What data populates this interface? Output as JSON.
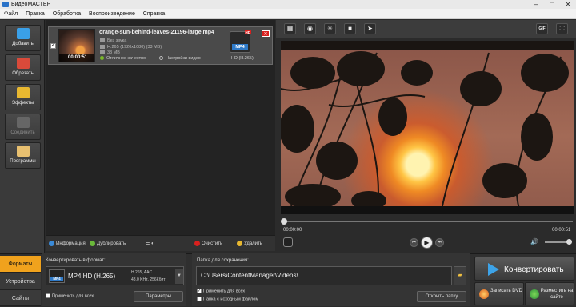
{
  "window": {
    "title": "ВидеоМАСТЕР"
  },
  "menu": [
    "Файл",
    "Правка",
    "Обработка",
    "Воспроизведение",
    "Справка"
  ],
  "sidebar": {
    "items": [
      {
        "label": "Добавить",
        "icon": "add-icon",
        "color": "#3aa0e8"
      },
      {
        "label": "Обрезать",
        "icon": "cut-icon",
        "color": "#d94a3a"
      },
      {
        "label": "Эффекты",
        "icon": "effects-icon",
        "color": "#e8b830"
      },
      {
        "label": "Соединить",
        "icon": "join-icon",
        "color": "#777777",
        "disabled": true
      },
      {
        "label": "Программы",
        "icon": "programs-icon",
        "color": "#e8c070"
      }
    ]
  },
  "file": {
    "name": "orange-sun-behind-leaves-21196-large.mp4",
    "audio": "Без звука",
    "codec_line": "H.265 (1920x1080) (33 MB)",
    "size": "33 MB",
    "duration": "00:00:51",
    "quality": "Отличное качество",
    "settings": "Настройки видео",
    "format_badge": "MP4",
    "hd_badge": "HD",
    "format_label": "HD (H.265)"
  },
  "listbar": {
    "info": "Информация",
    "duplicate": "Дублировать",
    "clear": "Очистить",
    "delete": "Удалить"
  },
  "player": {
    "time_current": "00:00:00",
    "time_total": "00:00:51",
    "gif_label": "GIF"
  },
  "bottom": {
    "tabs": [
      "Форматы",
      "Устройства",
      "Сайты"
    ],
    "convert_title": "Конвертировать в формат:",
    "format_name": "MP4 HD (H.265)",
    "format_codec": "H.265, AAC",
    "format_audio": "48,0 KHz, 256Кбит",
    "format_badge": "MP4",
    "apply_all": "Применить для всех",
    "params": "Параметры",
    "save_title": "Папка для сохранения:",
    "save_path": "C:\\Users\\ContentManager\\Videos\\",
    "apply_all_save": "Применить для всех",
    "source_folder": "Папка с исходным файлом",
    "open_folder": "Открыть папку",
    "convert": "Конвертировать",
    "burn_dvd": "Записать DVD",
    "publish": "Разместить на сайте"
  },
  "colors": {
    "accent": "#f0a21d",
    "blue": "#2f7ac8",
    "red": "#d9201e"
  }
}
